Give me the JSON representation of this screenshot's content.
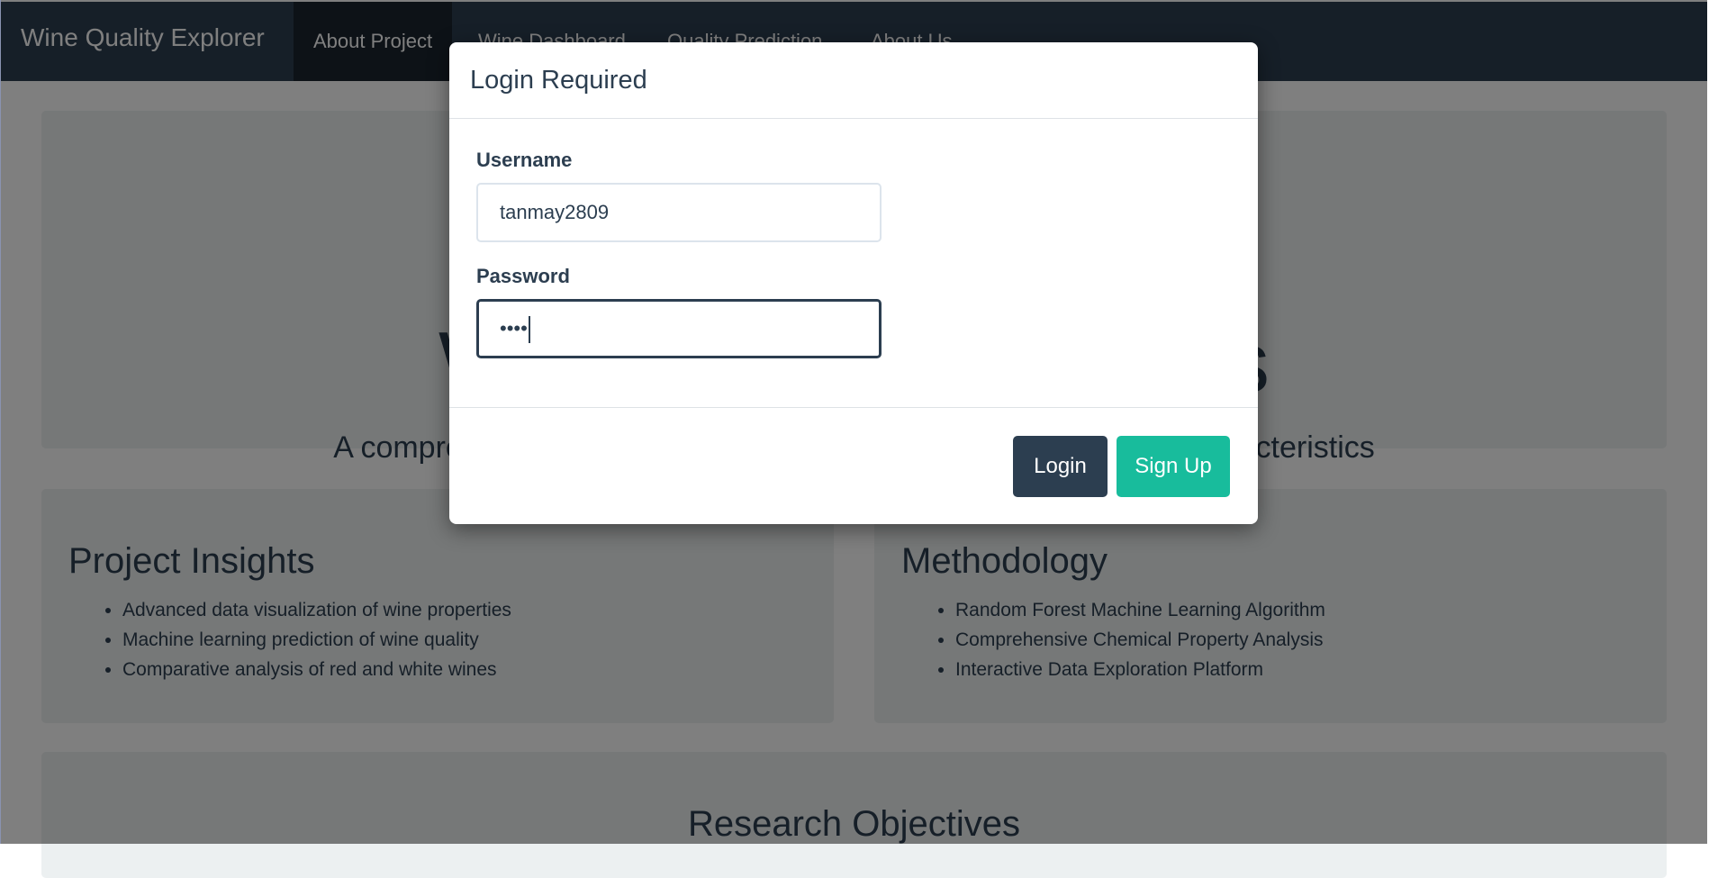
{
  "navbar": {
    "brand": "Wine Quality Explorer",
    "items": [
      {
        "label": "About Project",
        "active": true
      },
      {
        "label": "Wine Dashboard"
      },
      {
        "label": "Quality Prediction"
      },
      {
        "label": "About Us"
      }
    ]
  },
  "hero": {
    "title": "Wine Quality Analysis",
    "lead": "A comprehensive exploration of wine quality through chemical characteristics"
  },
  "insights": {
    "heading": "Project Insights",
    "items": [
      "Advanced data visualization of wine properties",
      "Machine learning prediction of wine quality",
      "Comparative analysis of red and white wines"
    ]
  },
  "methodology": {
    "heading": "Methodology",
    "items": [
      "Random Forest Machine Learning Algorithm",
      "Comprehensive Chemical Property Analysis",
      "Interactive Data Exploration Platform"
    ]
  },
  "research": {
    "heading": "Research Objectives"
  },
  "modal": {
    "title": "Login Required",
    "username_label": "Username",
    "username_value": "tanmay2809",
    "password_label": "Password",
    "password_masked": "••••",
    "login_label": "Login",
    "signup_label": "Sign Up"
  },
  "colors": {
    "primary": "#2c3e50",
    "primary_dark": "#1a252f",
    "accent": "#18bc9c",
    "card_bg": "#ecf0f1"
  }
}
